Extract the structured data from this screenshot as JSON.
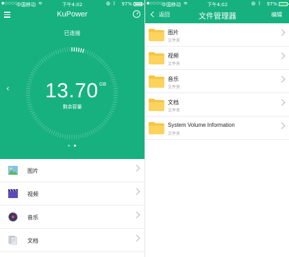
{
  "status_bar": {
    "signal": "●○○○○",
    "carrier": "中国移动",
    "time": "下午4:02",
    "battery": "97%"
  },
  "left": {
    "title": "KuPower",
    "connection_status": "已连接",
    "capacity_value": "13.70",
    "capacity_unit": "GB",
    "capacity_label": "剩余容量",
    "page_indicator": {
      "pages": 2,
      "active": 2
    },
    "categories": [
      {
        "label": "图片",
        "icon": "image-icon"
      },
      {
        "label": "视频",
        "icon": "video-icon"
      },
      {
        "label": "音乐",
        "icon": "music-icon"
      },
      {
        "label": "文档",
        "icon": "document-icon"
      }
    ]
  },
  "right": {
    "back_label": "返回",
    "title": "文件管理器",
    "edit_label": "编辑",
    "folders": [
      {
        "name": "图片",
        "type": "文件夹"
      },
      {
        "name": "视频",
        "type": "文件夹"
      },
      {
        "name": "音乐",
        "type": "文件夹"
      },
      {
        "name": "文档",
        "type": "文件夹"
      },
      {
        "name": "System Volume Information",
        "type": "文件夹"
      }
    ]
  },
  "colors": {
    "primary_green": "#16b17f",
    "folder_yellow": "#f6c542",
    "battery_green": "#4cd964"
  }
}
